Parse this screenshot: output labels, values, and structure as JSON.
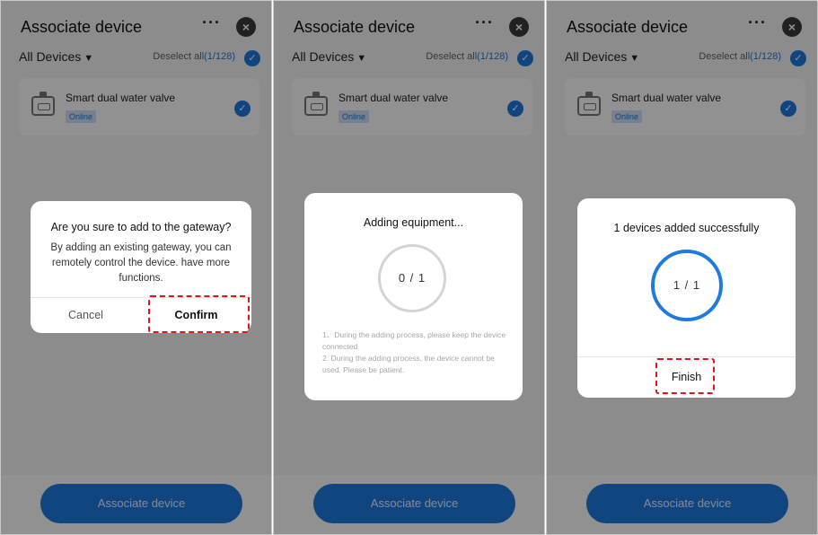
{
  "panels": [
    {
      "header": {
        "title": "Associate device",
        "more": "···",
        "close": "×"
      },
      "filter": {
        "label": "All Devices",
        "caret": "▼",
        "deselect_prefix": "Deselect all",
        "deselect_count": "(1/128)",
        "check": "✓"
      },
      "device": {
        "name": "Smart dual water valve",
        "status": "Online",
        "check": "✓"
      },
      "footer_button": "Associate device",
      "dialog": {
        "title": "Are you sure to add to the gateway?",
        "body": "By adding an existing gateway, you can remotely control the device. have more functions.",
        "cancel": "Cancel",
        "confirm": "Confirm"
      }
    },
    {
      "header": {
        "title": "Associate device",
        "more": "···",
        "close": "×"
      },
      "filter": {
        "label": "All Devices",
        "caret": "▼",
        "deselect_prefix": "Deselect all",
        "deselect_count": "(1/128)",
        "check": "✓"
      },
      "device": {
        "name": "Smart dual water valve",
        "status": "Online",
        "check": "✓"
      },
      "footer_button": "Associate device",
      "dialog": {
        "title": "Adding equipment...",
        "progress": "0 / 1",
        "tip1": "1、During the adding process, please keep the device connected",
        "tip2": "2. During the adding process, the device cannot be used. Please be patient."
      }
    },
    {
      "header": {
        "title": "Associate device",
        "more": "···",
        "close": "×"
      },
      "filter": {
        "label": "All Devices",
        "caret": "▼",
        "deselect_prefix": "Deselect all",
        "deselect_count": "(1/128)",
        "check": "✓"
      },
      "device": {
        "name": "Smart dual water valve",
        "status": "Online",
        "check": "✓"
      },
      "footer_button": "Associate device",
      "dialog": {
        "title": "1 devices added successfully",
        "progress": "1 / 1",
        "finish": "Finish"
      }
    }
  ],
  "colors": {
    "accent": "#1f7ae0",
    "highlight_box": "#e0141a",
    "progress_ring_idle": "#d4d4d4",
    "progress_ring_done": "#1f7ae0"
  }
}
